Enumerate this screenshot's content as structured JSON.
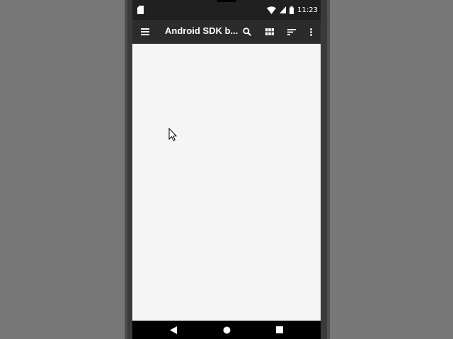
{
  "status_bar": {
    "time": "11:23",
    "icons": [
      "sd-card-icon",
      "wifi-icon",
      "signal-icon",
      "battery-icon"
    ]
  },
  "toolbar": {
    "title": "Android SDK b...",
    "icons": [
      "menu-icon",
      "search-icon",
      "grid-view-icon",
      "sort-icon",
      "more-vert-icon"
    ]
  },
  "nav_bar": {
    "icons": [
      "back-icon",
      "home-icon",
      "recents-icon"
    ]
  },
  "colors": {
    "background": "#777777",
    "status_bar": "#202020",
    "toolbar": "#2b2b2b",
    "content": "#f5f5f5",
    "nav_bar": "#000000"
  }
}
